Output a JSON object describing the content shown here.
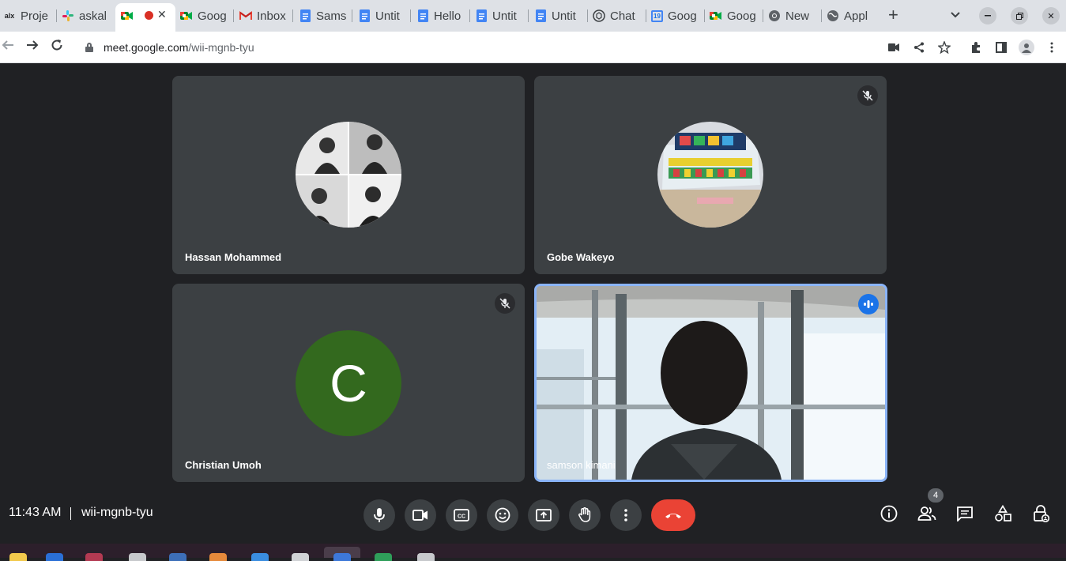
{
  "browser": {
    "tabs": [
      {
        "label": "Proje",
        "favicon": "alx-logo"
      },
      {
        "label": "askal",
        "favicon": "slack-icon"
      },
      {
        "label": "",
        "favicon": "meet-icon",
        "active": true,
        "recording": true
      },
      {
        "label": "Goog",
        "favicon": "meet-icon"
      },
      {
        "label": "Inbox",
        "favicon": "gmail-icon"
      },
      {
        "label": "Sams",
        "favicon": "docs-icon"
      },
      {
        "label": "Untit",
        "favicon": "docs-icon"
      },
      {
        "label": "Hello",
        "favicon": "docs-icon"
      },
      {
        "label": "Untit",
        "favicon": "docs-icon"
      },
      {
        "label": "Untit",
        "favicon": "docs-icon"
      },
      {
        "label": "Chat",
        "favicon": "chatgpt-icon"
      },
      {
        "label": "Goog",
        "favicon": "calendar-icon"
      },
      {
        "label": "Goog",
        "favicon": "meet-icon"
      },
      {
        "label": "New",
        "favicon": "chrome-icon"
      },
      {
        "label": "Appl",
        "favicon": "globe-icon"
      }
    ],
    "url_host": "meet.google.com",
    "url_path": "/wii-mgnb-tyu",
    "calendar_day": "19"
  },
  "meeting": {
    "participants": [
      {
        "name": "Hassan Mohammed",
        "muted": false
      },
      {
        "name": "Gobe Wakeyo",
        "muted": true
      },
      {
        "name": "Christian Umoh",
        "muted": true,
        "initial": "C"
      },
      {
        "name": "samson kimani",
        "speaking": true
      }
    ],
    "time": "11:43 AM",
    "code": "wii-mgnb-tyu",
    "people_count": "4"
  },
  "colors": {
    "background": "#202124",
    "tile": "#3c4043",
    "end_call": "#ea4335",
    "active_speaker": "#8ab4f8",
    "speaker_badge": "#1a73e8",
    "avatar_green": "#33691e"
  }
}
